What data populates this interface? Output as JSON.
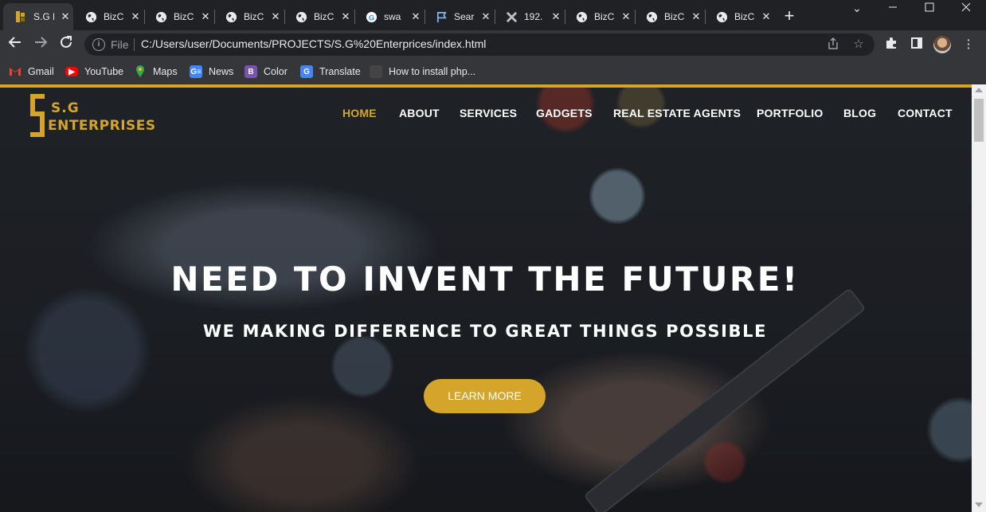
{
  "tabs": [
    {
      "title": "S.G E",
      "icon": "sg-logo-icon",
      "active": true
    },
    {
      "title": "BizC",
      "icon": "globe-icon"
    },
    {
      "title": "BizC",
      "icon": "globe-icon"
    },
    {
      "title": "BizC",
      "icon": "globe-icon"
    },
    {
      "title": "BizC",
      "icon": "globe-icon"
    },
    {
      "title": "swa",
      "icon": "google-icon"
    },
    {
      "title": "Sear",
      "icon": "flag-icon"
    },
    {
      "title": "192.",
      "icon": "x-icon"
    },
    {
      "title": "BizC",
      "icon": "globe-icon"
    },
    {
      "title": "BizC",
      "icon": "globe-icon"
    },
    {
      "title": "BizC",
      "icon": "globe-icon"
    }
  ],
  "toolbar": {
    "scheme": "File",
    "url": "C:/Users/user/Documents/PROJECTS/S.G%20Enterprices/index.html"
  },
  "bookmarks": [
    {
      "label": "Gmail",
      "icon": "gmail-icon",
      "color": "#ea4335"
    },
    {
      "label": "YouTube",
      "icon": "youtube-icon",
      "color": "#ff0000"
    },
    {
      "label": "Maps",
      "icon": "maps-icon",
      "color": "#34a853"
    },
    {
      "label": "News",
      "icon": "news-icon",
      "color": "#4285f4"
    },
    {
      "label": "Color",
      "icon": "bootstrap-icon",
      "color": "#7952b3"
    },
    {
      "label": "Translate",
      "icon": "translate-icon",
      "color": "#4285f4"
    },
    {
      "label": "How to install php...",
      "icon": "video-thumbnail-icon",
      "color": "#444444"
    }
  ],
  "site": {
    "logo_top": "S.G",
    "logo_bottom": "ENTERPRISES",
    "nav": [
      "HOME",
      "ABOUT",
      "SERVICES",
      "GADGETS",
      "REAL ESTATE AGENTS",
      "PORTFOLIO",
      "BLOG",
      "CONTACT"
    ],
    "active_nav": "HOME",
    "hero_title": "NEED TO INVENT THE FUTURE!",
    "hero_subtitle": "WE MAKING DIFFERENCE TO GREAT THINGS POSSIBLE",
    "cta_label": "LEARN MORE",
    "accent_color": "#d4a52a"
  }
}
